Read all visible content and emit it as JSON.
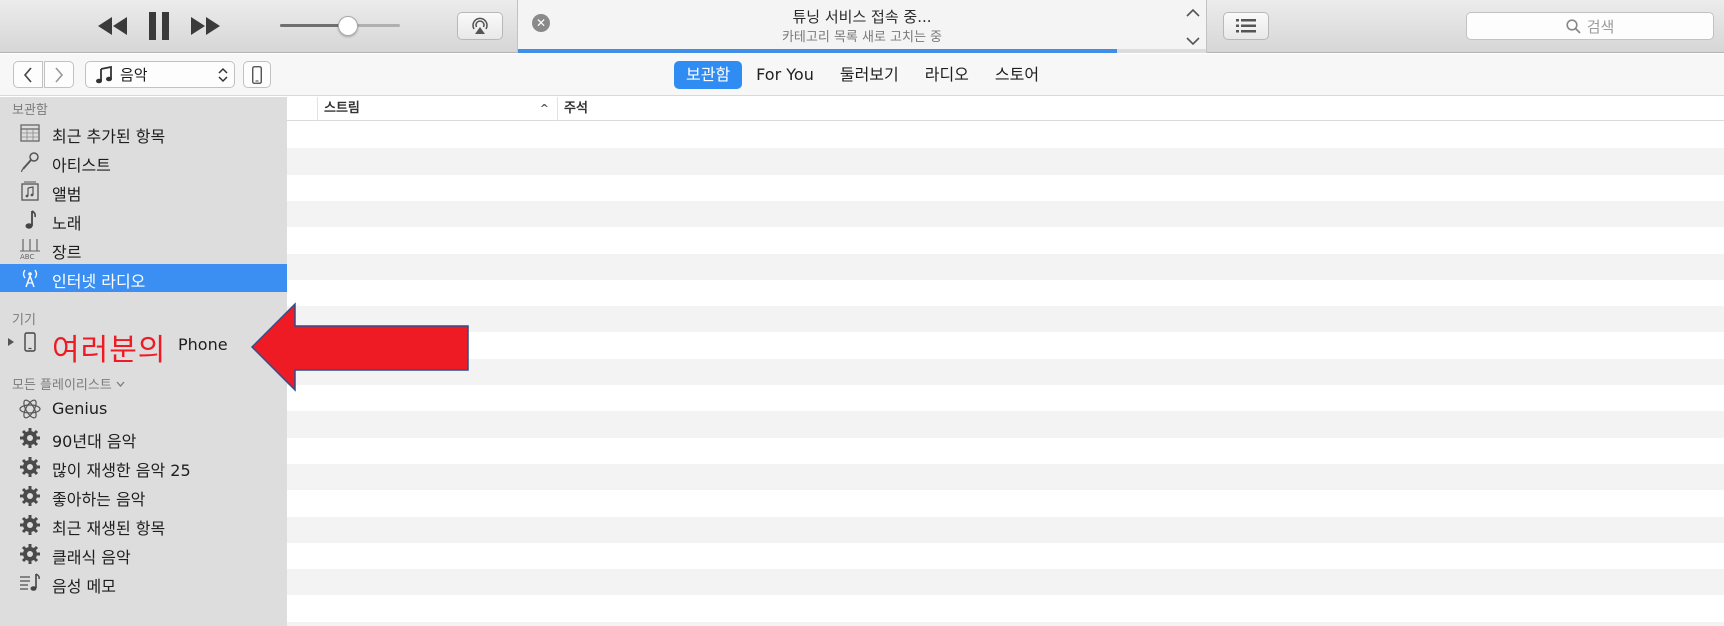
{
  "transport": {
    "prev_icon": "rewind-icon",
    "pause_icon": "pause-icon",
    "next_icon": "fast-forward-icon",
    "volume_level": 0.57,
    "airplay_icon": "airplay-icon"
  },
  "lcd": {
    "title": "튜닝 서비스 접속 중...",
    "subtitle": "카테고리 목록 새로 고치는 중",
    "close_glyph": "✕",
    "progress": 0.87
  },
  "search": {
    "label": "검색"
  },
  "nav": {
    "media_label": "음악",
    "tabs": [
      {
        "label": "보관함",
        "active": true
      },
      {
        "label": "For You",
        "active": false
      },
      {
        "label": "둘러보기",
        "active": false
      },
      {
        "label": "라디오",
        "active": false
      },
      {
        "label": "스토어",
        "active": false
      }
    ]
  },
  "sidebar": {
    "library_header": "보관함",
    "library_items": [
      {
        "label": "최근 추가된 항목",
        "icon": "calendar-grid-icon"
      },
      {
        "label": "아티스트",
        "icon": "microphone-icon"
      },
      {
        "label": "앨범",
        "icon": "album-icon"
      },
      {
        "label": "노래",
        "icon": "music-note-icon"
      },
      {
        "label": "장르",
        "icon": "genre-icon"
      },
      {
        "label": "인터넷 라디오",
        "icon": "radio-antenna-icon",
        "selected": true
      }
    ],
    "devices_header": "기기",
    "device_label": "Phone",
    "playlists_header": "모든 플레이리스트",
    "playlist_items": [
      {
        "label": "Genius",
        "icon": "genius-atom-icon"
      },
      {
        "label": "90년대 음악",
        "icon": "smart-playlist-gear-icon"
      },
      {
        "label": "많이 재생한 음악 25",
        "icon": "smart-playlist-gear-icon"
      },
      {
        "label": "좋아하는 음악",
        "icon": "smart-playlist-gear-icon"
      },
      {
        "label": "최근 재생된 항목",
        "icon": "smart-playlist-gear-icon"
      },
      {
        "label": "클래식 음악",
        "icon": "smart-playlist-gear-icon"
      },
      {
        "label": "음성 메모",
        "icon": "voice-memo-icon"
      }
    ]
  },
  "content": {
    "columns": [
      "스트림",
      "주석"
    ],
    "sort_glyph": "^"
  },
  "annotation": {
    "text": "여러분의",
    "color": "#ee1b24"
  }
}
